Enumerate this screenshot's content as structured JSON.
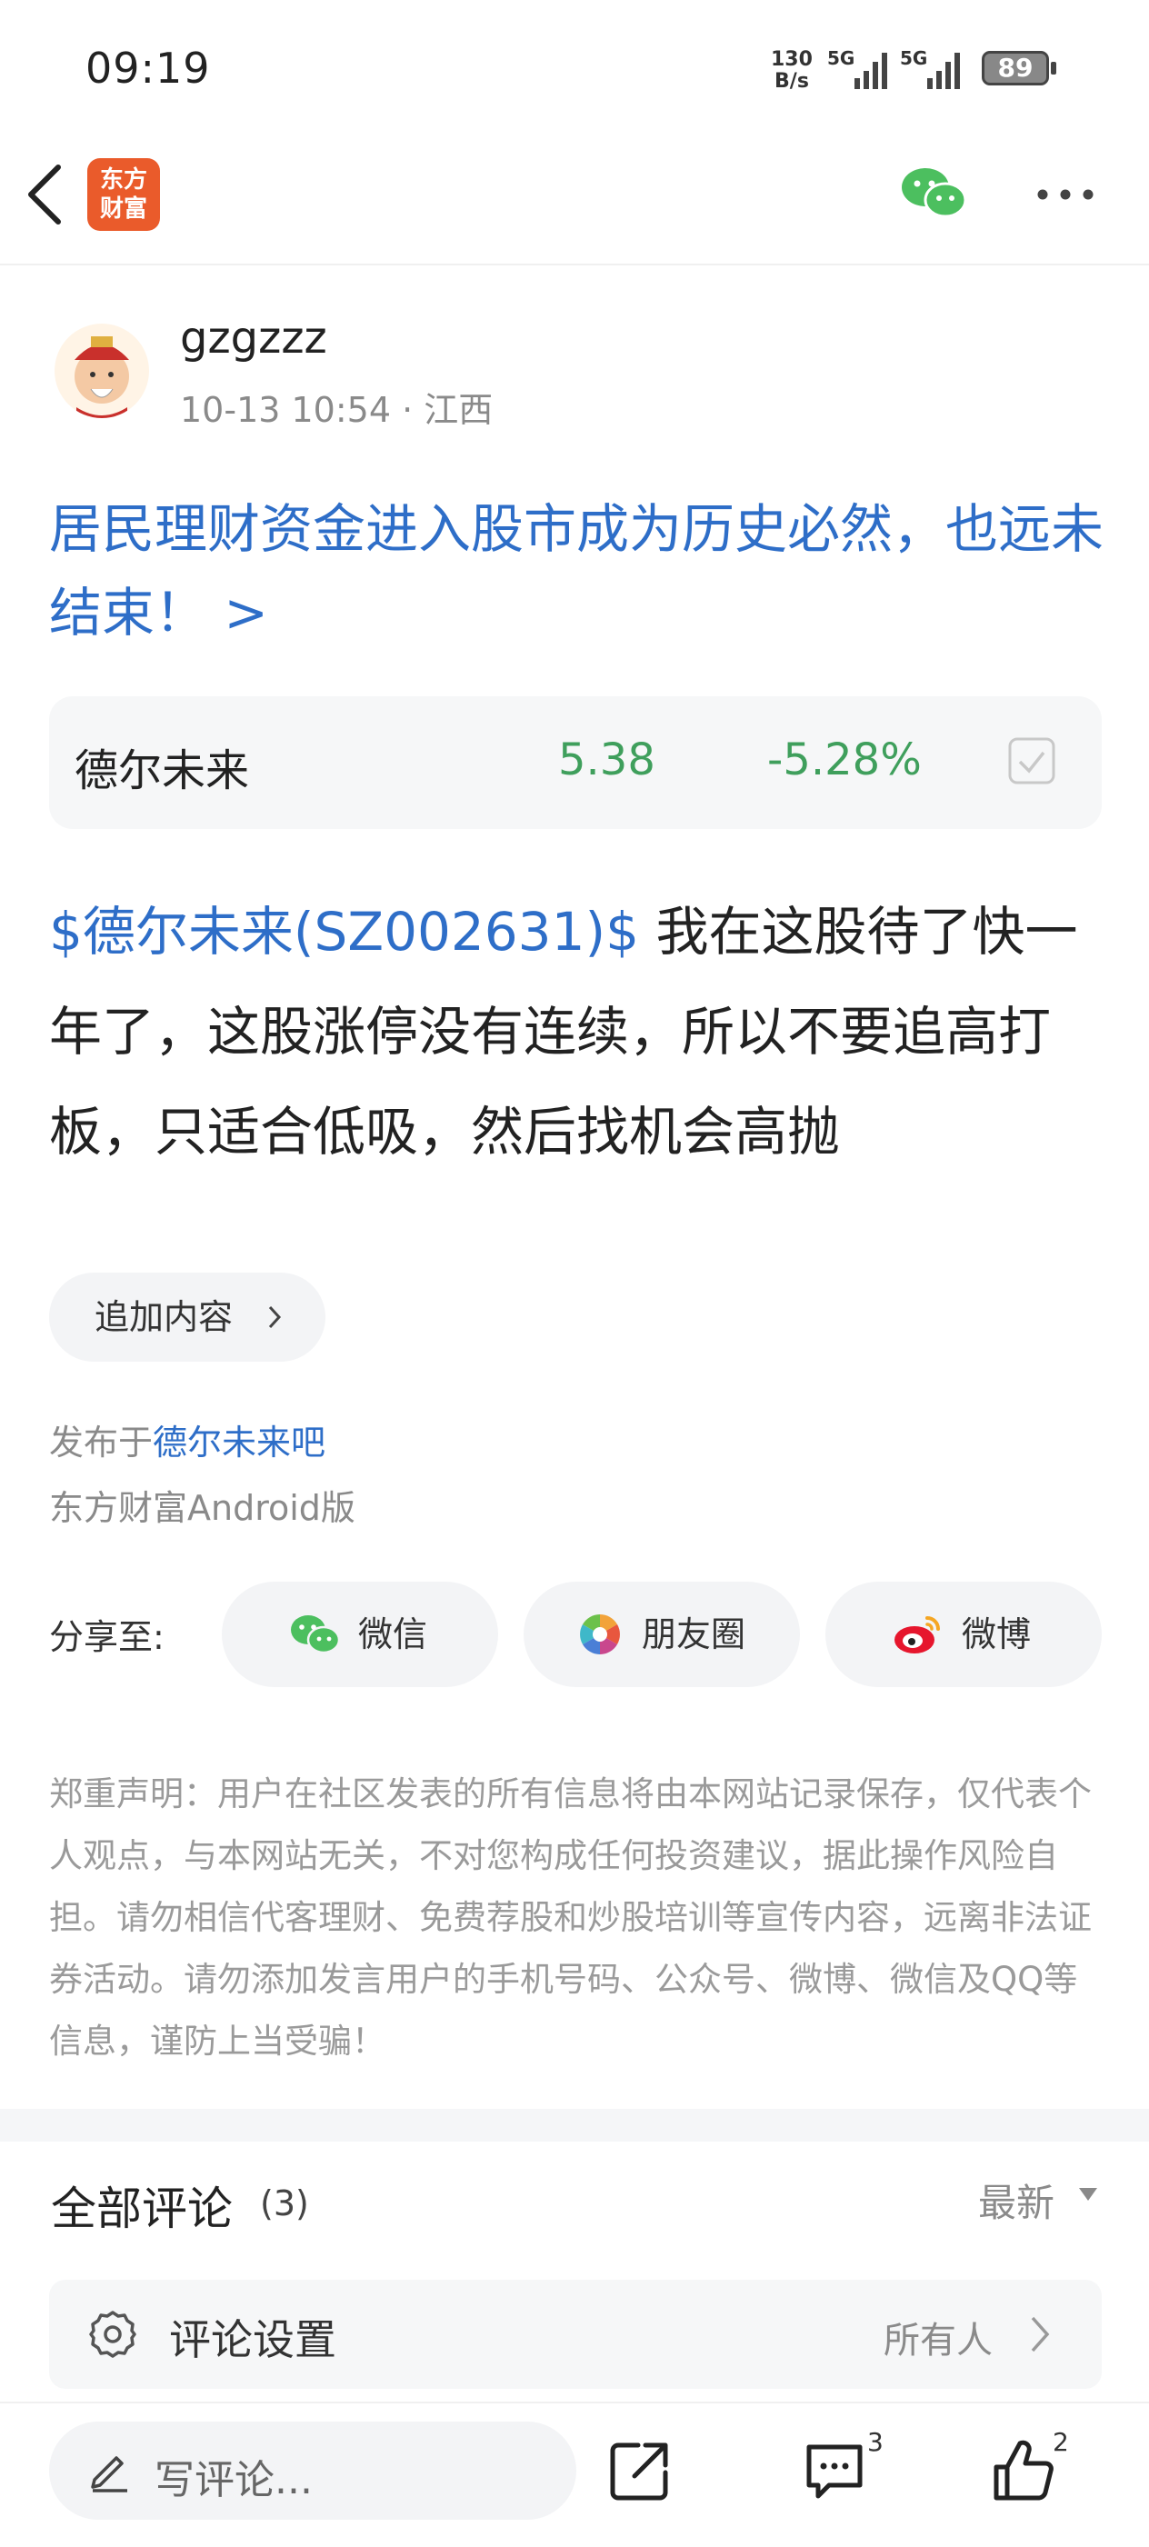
{
  "status_bar": {
    "time": "09:19",
    "net_speed_value": "130",
    "net_speed_unit": "B/s",
    "signal1": "5G",
    "signal2": "5G",
    "battery": "89"
  },
  "header": {
    "logo_line1": "东方",
    "logo_line2": "财富"
  },
  "author": {
    "name": "gzgzzz",
    "meta": "10-13 10:54 · 江西"
  },
  "post": {
    "title": "居民理财资金进入股市成为历史必然，也远未结束！ >",
    "stock": {
      "name": "德尔未来",
      "price": "5.38",
      "change": "-5.28%"
    },
    "content_tag": "$德尔未来(SZ002631)$",
    "content_text": " 我在这股待了快一年了，这股涨停没有连续，所以不要追高打板，只适合低吸，然后找机会高抛",
    "append_label": "追加内容"
  },
  "publish": {
    "prefix": "发布于",
    "bar_name": "德尔未来吧",
    "client": "东方财富Android版"
  },
  "share": {
    "label": "分享至:",
    "wechat": "微信",
    "moments": "朋友圈",
    "weibo": "微博"
  },
  "disclaimer": "郑重声明：用户在社区发表的所有信息将由本网站记录保存，仅代表个人观点，与本网站无关，不对您构成任何投资建议，据此操作风险自担。请勿相信代客理财、免费荐股和炒股培训等宣传内容，远离非法证券活动。请勿添加发言用户的手机号码、公众号、微博、微信及QQ等信息，谨防上当受骗！",
  "comments": {
    "title": "全部评论",
    "count": "(3)",
    "sort": "最新",
    "settings_label": "评论设置",
    "settings_value": "所有人"
  },
  "bottom_bar": {
    "input_placeholder": "写评论...",
    "comment_count": "3",
    "like_count": "2"
  },
  "colors": {
    "link_blue": "#2e6ec8",
    "stock_green": "#3f9f5c",
    "brand_orange": "#ea5b2b"
  }
}
